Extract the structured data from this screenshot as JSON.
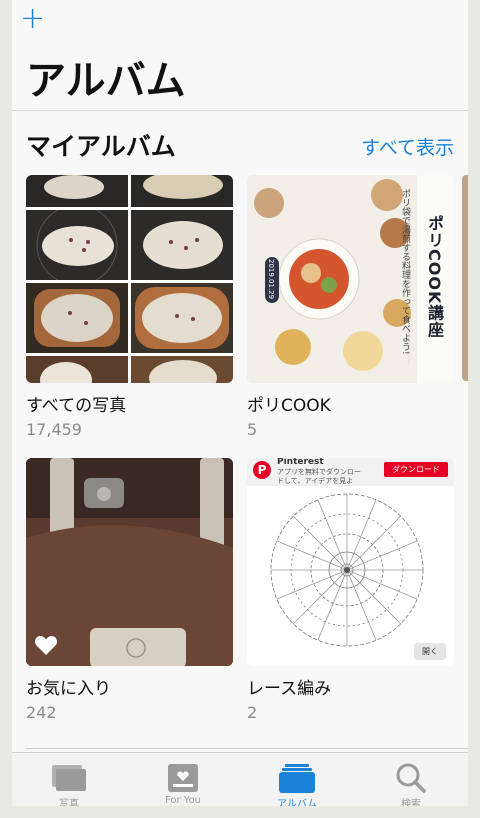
{
  "header": {
    "add_label": "+",
    "title": "アルバム"
  },
  "section": {
    "title": "マイアルバム",
    "see_all": "すべて表示"
  },
  "albums": [
    {
      "name": "すべての写真",
      "count": "17,459"
    },
    {
      "name": "ポリCOOK",
      "count": "5"
    },
    {
      "name": "お気に入り",
      "count": "242"
    },
    {
      "name": "レース編み",
      "count": "2"
    }
  ],
  "thumbs": {
    "poly": {
      "vertical_title": "ポリCOOK講座",
      "vertical_subtitle": "ポリ袋で湯煎する料理を作って食べよう!",
      "date": "2019.01.29"
    },
    "lace": {
      "brand": "Pinterest",
      "line1": "アプリを無料でダウンロー",
      "line2": "ドして、アイデアを見よ",
      "download": "ダウンロード",
      "open": "開く"
    }
  },
  "tabs": [
    {
      "label": "写真",
      "icon": "photos-icon"
    },
    {
      "label": "For You",
      "icon": "for-you-icon"
    },
    {
      "label": "アルバム",
      "icon": "albums-icon"
    },
    {
      "label": "検索",
      "icon": "search-icon"
    }
  ],
  "colors": {
    "accent": "#1a82d8"
  }
}
